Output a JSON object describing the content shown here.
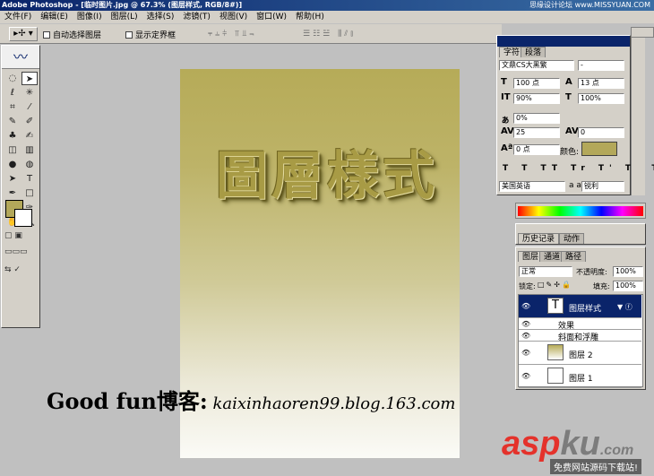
{
  "titlebar": {
    "title": "Adobe Photoshop - [临时图片.jpg @ 67.3% (图层样式, RGB/8#)]",
    "watermark": "思缘设计论坛 www.MISSYUAN.COM"
  },
  "menu": [
    "文件(F)",
    "编辑(E)",
    "图像(I)",
    "图层(L)",
    "选择(S)",
    "滤镜(T)",
    "视图(V)",
    "窗口(W)",
    "帮助(H)"
  ],
  "options": {
    "auto_select": "自动选择图层",
    "show_bounds": "显示定界框"
  },
  "char_panel": {
    "tabs": [
      "字符",
      "段落"
    ],
    "font": "文鼎CS大黑繁",
    "style": "-",
    "size": "100 点",
    "leading": "13 点",
    "vscale": "90%",
    "hscale": "100%",
    "tracking_baseline": "0%",
    "tracking": "25",
    "kerning": "0",
    "baseline": "0 点",
    "color_label": "颜色:",
    "color": "#b3a85a",
    "language": "美国英语",
    "aa_glyph": "a a",
    "antialias": "锐利",
    "type_buttons": [
      "T",
      "T",
      "TT",
      "Tr",
      "T'",
      "T,",
      "T",
      "Ŧ"
    ]
  },
  "history_panel": {
    "tabs": [
      "历史记录",
      "动作"
    ]
  },
  "layers_panel": {
    "tabs": [
      "图层",
      "通道",
      "路径"
    ],
    "blend_mode": "正常",
    "opacity_label": "不透明度:",
    "opacity": "100%",
    "lock_label": "锁定:",
    "fill_label": "填充:",
    "fill": "100%",
    "layers": [
      {
        "name": "图层样式",
        "type": "text",
        "selected": true
      },
      {
        "name": "效果",
        "type": "effects"
      },
      {
        "name": "斜面和浮雕",
        "type": "effect"
      },
      {
        "name": "图层 2",
        "type": "gradient"
      },
      {
        "name": "图层 1",
        "type": "white"
      }
    ]
  },
  "canvas": {
    "art_text": "圖層樣式",
    "gradient_top": "#b6ab58",
    "gradient_bottom": "#fbfbf7"
  },
  "caption": {
    "brand": "Good fun博客:",
    "url": "kaixinhaoren99.blog.163.com"
  },
  "watermark": {
    "red": "asp",
    "gray": "ku",
    "suffix": ".com",
    "sub": "免费网站源码下载站!"
  },
  "toolbox": {
    "fg_color": "#b3a85a",
    "bg_color": "#ffffff",
    "tools": [
      "marquee-icon",
      "move-icon",
      "lasso-icon",
      "magic-wand-icon",
      "crop-icon",
      "slice-icon",
      "healing-icon",
      "brush-icon",
      "stamp-icon",
      "history-brush-icon",
      "eraser-icon",
      "gradient-icon",
      "blur-icon",
      "dodge-icon",
      "path-select-icon",
      "type-icon",
      "pen-icon",
      "shape-icon",
      "notes-icon",
      "eyedropper-icon",
      "hand-icon",
      "zoom-icon"
    ],
    "glyphs": [
      "◌",
      "➤",
      "ℓ",
      "✳",
      "⌗",
      "⁄",
      "✎",
      "✐",
      "♣",
      "✍",
      "◫",
      "▥",
      "●",
      "◍",
      "➤",
      "T",
      "✒",
      "□",
      "▤",
      "✑",
      "✋",
      "🔍"
    ]
  }
}
